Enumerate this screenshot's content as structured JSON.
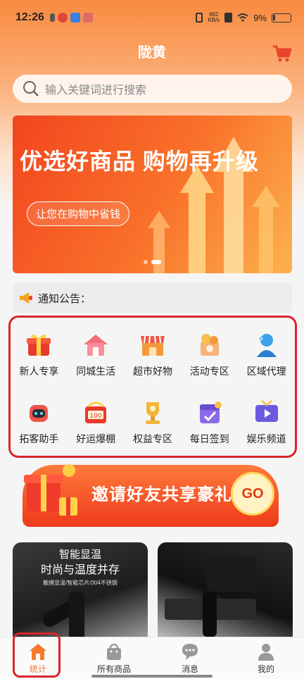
{
  "status_bar": {
    "time": "12:26",
    "network_speed": "662",
    "network_unit": "KB/s",
    "battery": "9%"
  },
  "header": {
    "title": "陇黄",
    "cart_icon": "shopping-cart-icon"
  },
  "search": {
    "placeholder": "输入关键词进行搜索",
    "icon": "search-icon"
  },
  "banner": {
    "title": "优选好商品 购物再升级",
    "tagline": "让您在购物中省钱",
    "slide_count": 2,
    "active_slide": 2
  },
  "notice": {
    "label": "通知公告：",
    "icon": "megaphone-icon"
  },
  "categories": [
    {
      "label": "新人专享",
      "icon": "gift-box-icon"
    },
    {
      "label": "同城生活",
      "icon": "house-icon"
    },
    {
      "label": "超市好物",
      "icon": "store-icon"
    },
    {
      "label": "活动专区",
      "icon": "coin-box-icon"
    },
    {
      "label": "区域代理",
      "icon": "agent-person-icon"
    },
    {
      "label": "拓客助手",
      "icon": "robot-icon"
    },
    {
      "label": "好运爆棚",
      "icon": "lucky-draw-icon"
    },
    {
      "label": "权益专区",
      "icon": "trophy-icon"
    },
    {
      "label": "每日签到",
      "icon": "calendar-checkin-icon"
    },
    {
      "label": "娱乐频道",
      "icon": "tv-play-icon"
    }
  ],
  "promo": {
    "text": "邀请好友共享豪礼",
    "go_label": "GO"
  },
  "products": [
    {
      "line1": "智能显温",
      "line2": "时尚与温度并存",
      "line3": "触摸显温/智能芯片/304不锈钢"
    },
    {
      "line1": "",
      "line2": "",
      "line3": ""
    }
  ],
  "tabbar": [
    {
      "label": "统计",
      "icon": "home-icon",
      "active": true
    },
    {
      "label": "所有商品",
      "icon": "shopping-bag-icon",
      "active": false
    },
    {
      "label": "消息",
      "icon": "chat-bubble-icon",
      "active": false
    },
    {
      "label": "我的",
      "icon": "user-icon",
      "active": false
    }
  ],
  "colors": {
    "accent": "#f47a2a",
    "highlight_border": "#d9252c",
    "banner_red": "#f2451f"
  }
}
